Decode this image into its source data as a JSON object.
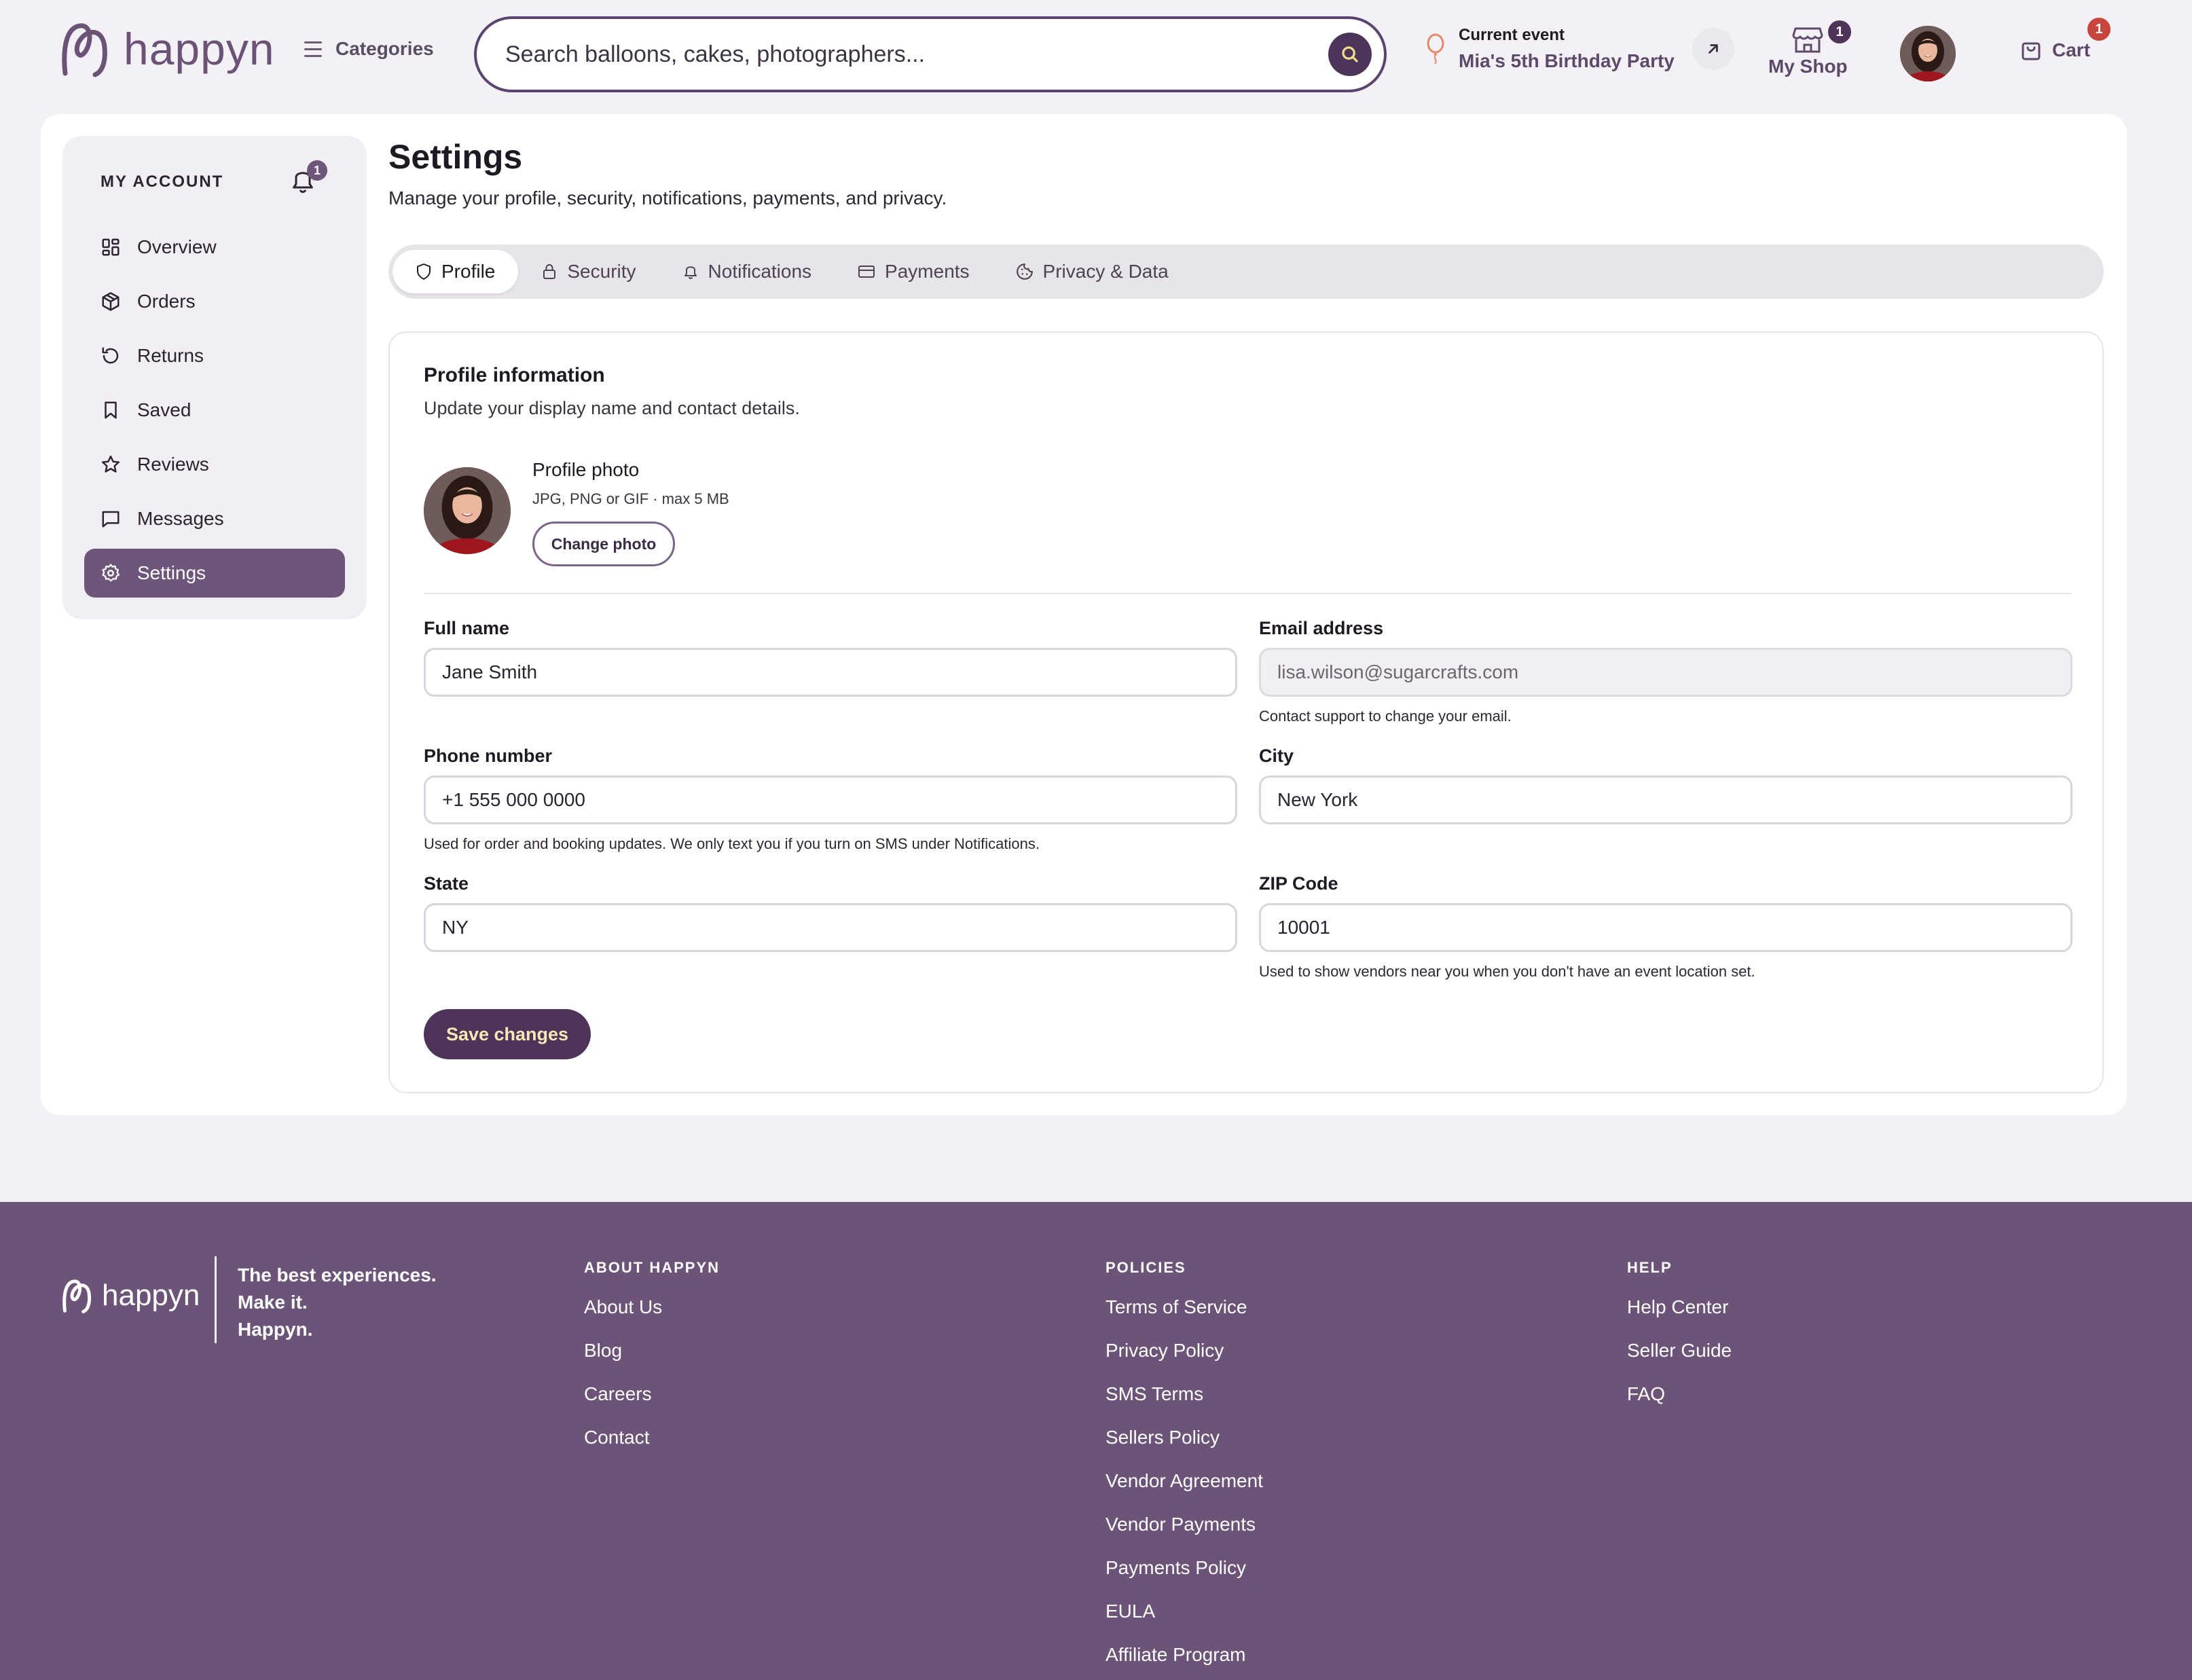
{
  "brand": {
    "name": "happyn"
  },
  "header": {
    "categories_label": "Categories",
    "search_placeholder": "Search balloons, cakes, photographers...",
    "event_label": "Current event",
    "event_name": "Mia's 5th Birthday Party",
    "myshop_label": "My Shop",
    "myshop_badge": "1",
    "cart_label": "Cart",
    "cart_badge": "1"
  },
  "sidebar": {
    "heading": "MY ACCOUNT",
    "bell_badge": "1",
    "items": [
      {
        "label": "Overview",
        "icon": "grid-icon"
      },
      {
        "label": "Orders",
        "icon": "box-icon"
      },
      {
        "label": "Returns",
        "icon": "rotate-icon"
      },
      {
        "label": "Saved",
        "icon": "bookmark-icon"
      },
      {
        "label": "Reviews",
        "icon": "star-icon"
      },
      {
        "label": "Messages",
        "icon": "message-icon"
      },
      {
        "label": "Settings",
        "icon": "gear-icon",
        "active": true
      }
    ]
  },
  "page": {
    "title": "Settings",
    "subtitle": "Manage your profile, security, notifications, payments, and privacy."
  },
  "tabs": [
    {
      "label": "Profile",
      "icon": "shield-icon",
      "active": true
    },
    {
      "label": "Security",
      "icon": "lock-icon"
    },
    {
      "label": "Notifications",
      "icon": "bell-icon"
    },
    {
      "label": "Payments",
      "icon": "card-icon"
    },
    {
      "label": "Privacy & Data",
      "icon": "cookie-icon"
    }
  ],
  "profile": {
    "title": "Profile information",
    "subtitle": "Update your display name and contact details.",
    "photo_title": "Profile photo",
    "photo_hint": "JPG, PNG or GIF · max 5 MB",
    "change_photo": "Change photo",
    "fields": {
      "full_name": {
        "label": "Full name",
        "value": "Jane Smith"
      },
      "email": {
        "label": "Email address",
        "value": "lisa.wilson@sugarcrafts.com",
        "help": "Contact support to change your email."
      },
      "phone": {
        "label": "Phone number",
        "value": "+1 555 000 0000",
        "help": "Used for order and booking updates. We only text you if you turn on SMS under Notifications."
      },
      "city": {
        "label": "City",
        "value": "New York"
      },
      "state": {
        "label": "State",
        "value": "NY"
      },
      "zip": {
        "label": "ZIP Code",
        "value": "10001",
        "help": "Used to show vendors near you when you don't have an event location set."
      }
    },
    "save_label": "Save changes"
  },
  "footer": {
    "tagline": [
      "The best experiences.",
      "Make it.",
      "Happyn."
    ],
    "columns": [
      {
        "title": "ABOUT HAPPYN",
        "links": [
          "About Us",
          "Blog",
          "Careers",
          "Contact"
        ]
      },
      {
        "title": "POLICIES",
        "links": [
          "Terms of Service",
          "Privacy Policy",
          "SMS Terms",
          "Sellers Policy",
          "Vendor Agreement",
          "Vendor Payments",
          "Payments Policy",
          "EULA",
          "Affiliate Program"
        ]
      },
      {
        "title": "HELP",
        "links": [
          "Help Center",
          "Seller Guide",
          "FAQ"
        ]
      }
    ]
  },
  "colors": {
    "brand_purple": "#6c5479",
    "dark_purple": "#4f3459",
    "badge_red": "#c8453b",
    "active_nav": "#6d5679"
  }
}
